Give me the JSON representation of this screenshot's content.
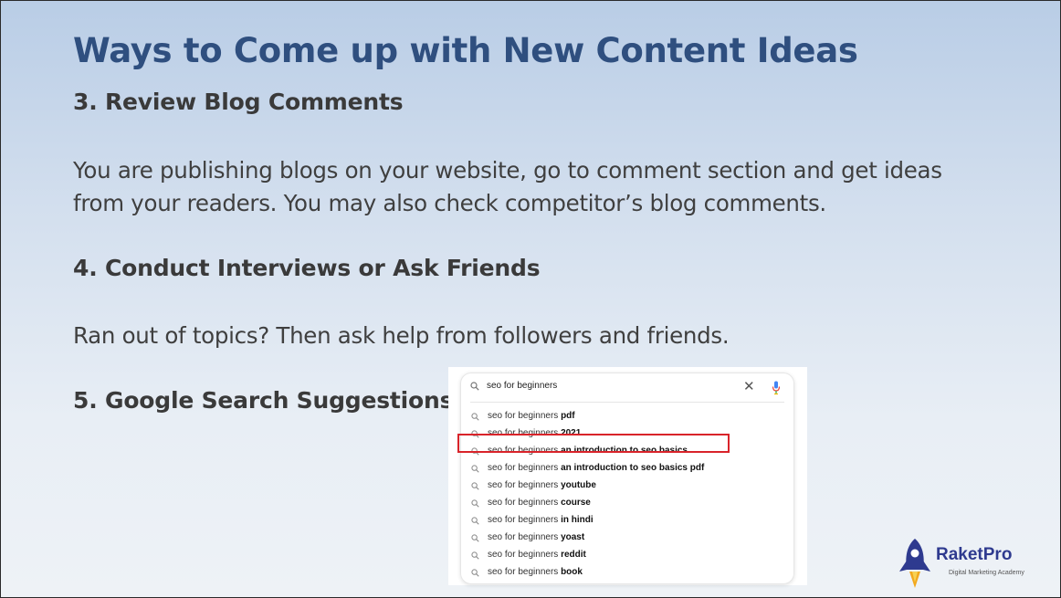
{
  "slide": {
    "title": "Ways to Come up with New Content Ideas",
    "sections": [
      {
        "heading": "3. Review Blog Comments",
        "body": "You are publishing blogs on your website, go to comment section and get ideas from your readers. You may also check competitor’s blog comments."
      },
      {
        "heading": "4. Conduct Interviews or Ask Friends",
        "body": "Ran out of topics? Then ask help from followers and friends."
      },
      {
        "heading": "5. Google Search Suggestions"
      }
    ]
  },
  "search": {
    "query": "seo for beginners",
    "clear_symbol": "✕",
    "suggestions": [
      {
        "prefix": "seo for beginners",
        "bold": "pdf"
      },
      {
        "prefix": "seo for beginners",
        "bold": "2021"
      },
      {
        "prefix": "seo for beginners",
        "bold": "an introduction to seo basics",
        "highlighted": true
      },
      {
        "prefix": "seo for beginners",
        "bold": "an introduction to seo basics pdf"
      },
      {
        "prefix": "seo for beginners",
        "bold": "youtube"
      },
      {
        "prefix": "seo for beginners",
        "bold": "course"
      },
      {
        "prefix": "seo for beginners",
        "bold": "in hindi"
      },
      {
        "prefix": "seo for beginners",
        "bold": "yoast"
      },
      {
        "prefix": "seo for beginners",
        "bold": "reddit"
      },
      {
        "prefix": "seo for beginners",
        "bold": "book"
      }
    ],
    "highlight_color": "#d9232a"
  },
  "logo": {
    "name": "RaketPro",
    "tagline": "Digital Marketing Academy",
    "color": "#2e3a8f"
  },
  "colors": {
    "title": "#2f4f7f",
    "text": "#3f3f3f"
  }
}
